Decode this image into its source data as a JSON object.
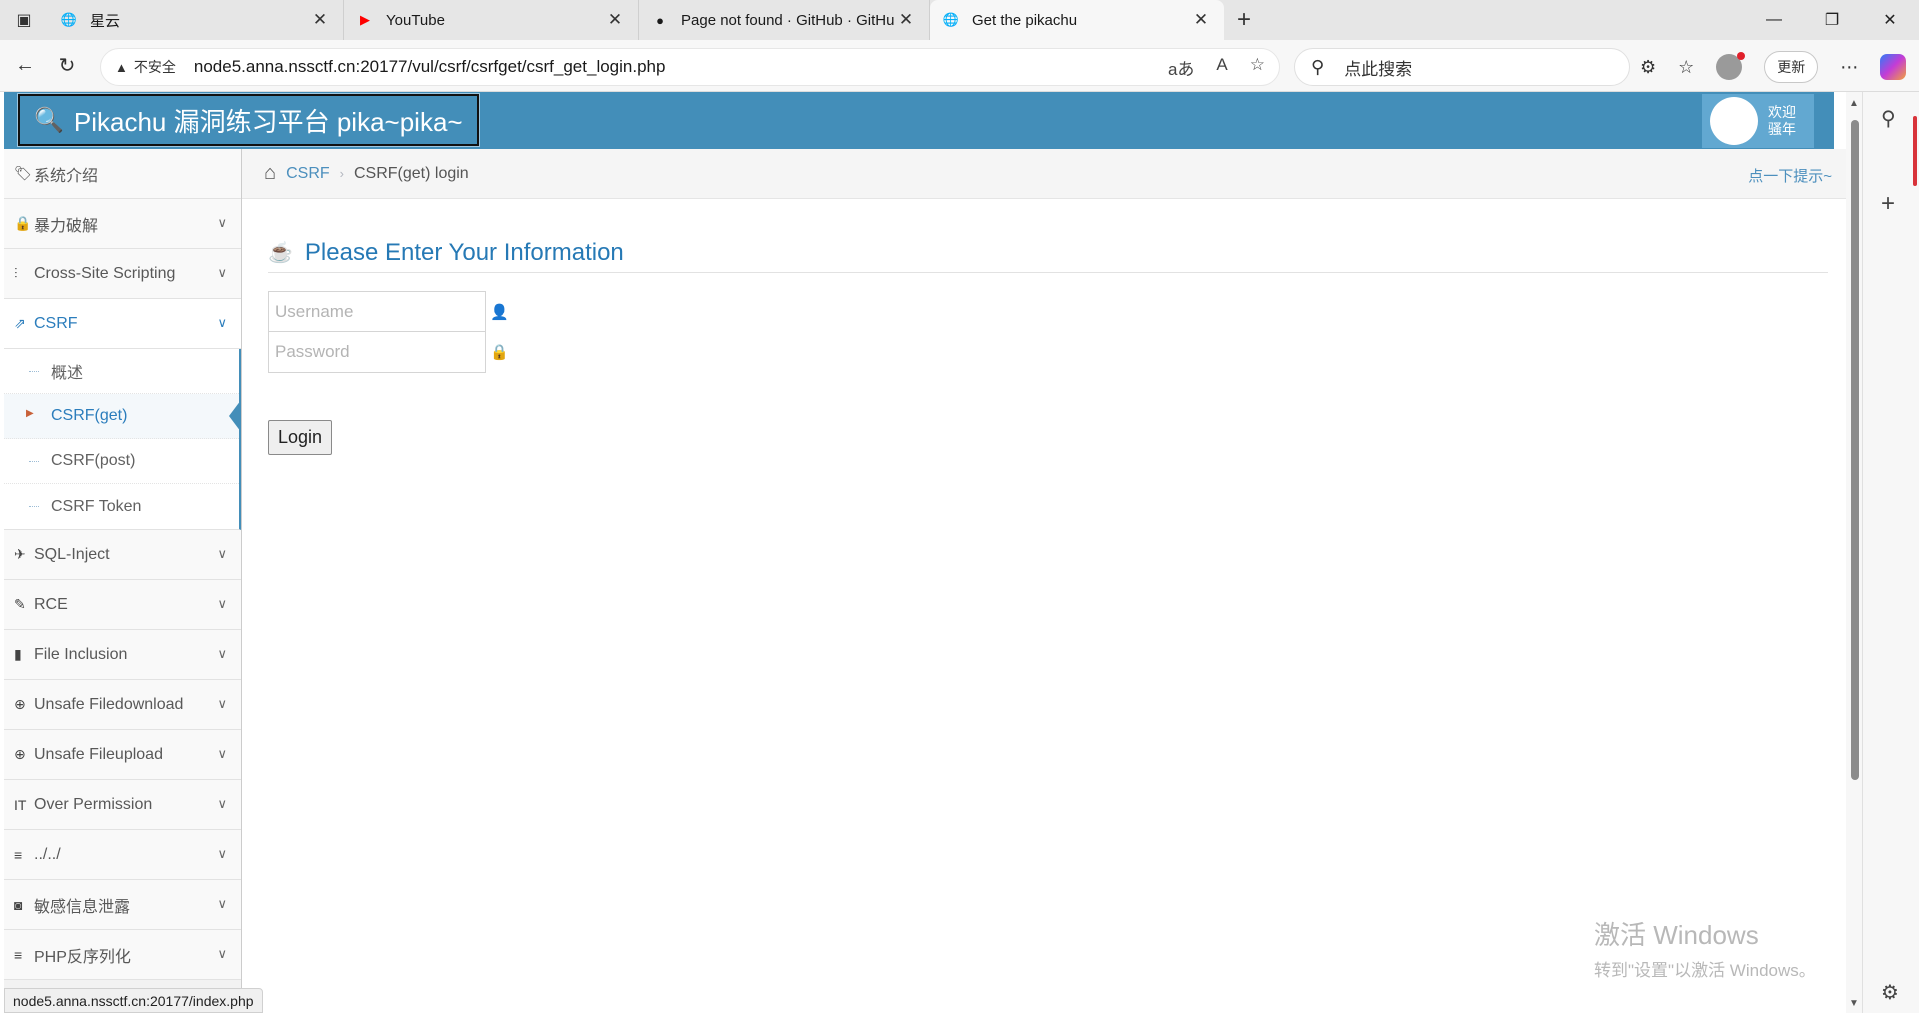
{
  "browser": {
    "tabs": [
      {
        "title": "星云",
        "favicon": "globe-icon",
        "active": false
      },
      {
        "title": "YouTube",
        "favicon": "youtube-icon",
        "active": false
      },
      {
        "title": "Page not found · GitHub · GitHub",
        "favicon": "github-icon",
        "active": false
      },
      {
        "title": "Get the pikachu",
        "favicon": "globe-icon",
        "active": true
      }
    ],
    "address": {
      "security_label": "不安全",
      "url": "node5.anna.nssctf.cn:20177/vul/csrf/csrfget/csrf_get_login.php"
    },
    "search_placeholder": "点此搜索",
    "update_label": "更新",
    "status_url": "node5.anna.nssctf.cn:20177/index.php"
  },
  "site": {
    "brand": "Pikachu 漏洞练习平台 pika~pika~",
    "welcome_line1": "欢迎",
    "welcome_line2": "骚年"
  },
  "sidebar": {
    "items": [
      {
        "label": "系统介绍",
        "icon": "tags-icon"
      },
      {
        "label": "暴力破解",
        "icon": "lock-icon"
      },
      {
        "label": "Cross-Site Scripting",
        "icon": "list-icon"
      },
      {
        "label": "CSRF",
        "icon": "share-icon"
      },
      {
        "label": "SQL-Inject",
        "icon": "plane-icon"
      },
      {
        "label": "RCE",
        "icon": "pencil-icon"
      },
      {
        "label": "File Inclusion",
        "icon": "file-icon"
      },
      {
        "label": "Unsafe Filedownload",
        "icon": "download-icon"
      },
      {
        "label": "Unsafe Fileupload",
        "icon": "upload-icon"
      },
      {
        "label": "Over Permission",
        "icon": "text-height-icon"
      },
      {
        "label": "../../",
        "icon": "align-left-icon"
      },
      {
        "label": "敏感信息泄露",
        "icon": "camera-icon"
      },
      {
        "label": "PHP反序列化",
        "icon": "align-left-icon"
      }
    ],
    "csrf_submenu": [
      {
        "label": "概述"
      },
      {
        "label": "CSRF(get)"
      },
      {
        "label": "CSRF(post)"
      },
      {
        "label": "CSRF Token"
      }
    ]
  },
  "breadcrumb": {
    "section": "CSRF",
    "current": "CSRF(get) login",
    "hint": "点一下提示~"
  },
  "main": {
    "title": "Please Enter Your Information",
    "username_placeholder": "Username",
    "password_placeholder": "Password",
    "login_label": "Login"
  },
  "watermark": {
    "line1": "激活 Windows",
    "line2": "转到\"设置\"以激活 Windows。"
  },
  "colors": {
    "header": "#438eb9",
    "link": "#4c8fbd",
    "title": "#2679b5"
  }
}
